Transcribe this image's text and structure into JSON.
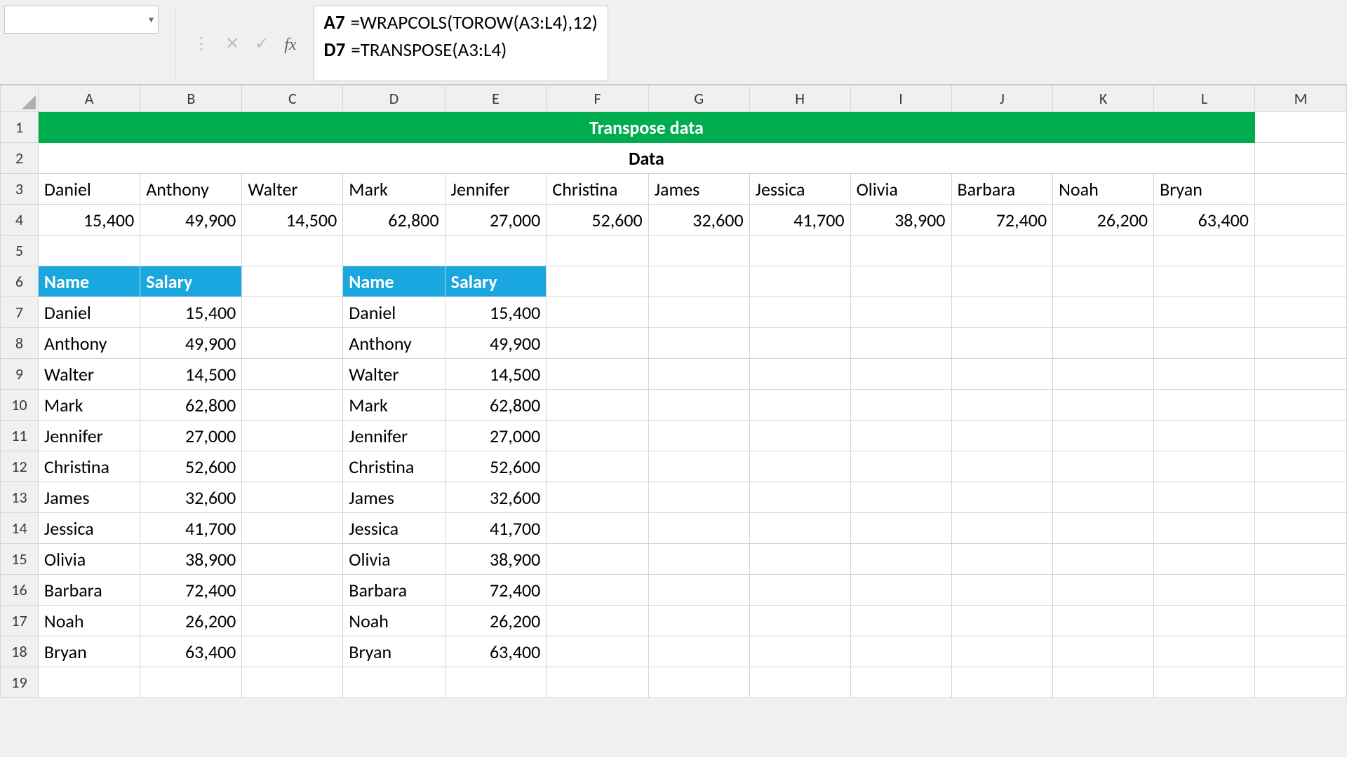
{
  "formula_bar": {
    "name_box_value": "",
    "lines": [
      {
        "ref": "A7",
        "formula": "=WRAPCOLS(TOROW(A3:L4),12)"
      },
      {
        "ref": "D7",
        "formula": "=TRANSPOSE(A3:L4)"
      }
    ]
  },
  "icons": {
    "dropdown": "▾",
    "menu_dots": "⋮",
    "cancel": "✕",
    "enter": "✓",
    "fx": "fx"
  },
  "columns": [
    "A",
    "B",
    "C",
    "D",
    "E",
    "F",
    "G",
    "H",
    "I",
    "J",
    "K",
    "L",
    "M"
  ],
  "row_numbers": [
    1,
    2,
    3,
    4,
    5,
    6,
    7,
    8,
    9,
    10,
    11,
    12,
    13,
    14,
    15,
    16,
    17,
    18,
    19
  ],
  "title_row": "Transpose data",
  "data_label": "Data",
  "names_row": [
    "Daniel",
    "Anthony",
    "Walter",
    "Mark",
    "Jennifer",
    "Christina",
    "James",
    "Jessica",
    "Olivia",
    "Barbara",
    "Noah",
    "Bryan"
  ],
  "salary_row": [
    "15,400",
    "49,900",
    "14,500",
    "62,800",
    "27,000",
    "52,600",
    "32,600",
    "41,700",
    "38,900",
    "72,400",
    "26,200",
    "63,400"
  ],
  "table_headers": {
    "name": "Name",
    "salary": "Salary"
  },
  "tableA": [
    {
      "name": "Daniel",
      "salary": "15,400"
    },
    {
      "name": "Anthony",
      "salary": "49,900"
    },
    {
      "name": "Walter",
      "salary": "14,500"
    },
    {
      "name": "Mark",
      "salary": "62,800"
    },
    {
      "name": "Jennifer",
      "salary": "27,000"
    },
    {
      "name": "Christina",
      "salary": "52,600"
    },
    {
      "name": "James",
      "salary": "32,600"
    },
    {
      "name": "Jessica",
      "salary": "41,700"
    },
    {
      "name": "Olivia",
      "salary": "38,900"
    },
    {
      "name": "Barbara",
      "salary": "72,400"
    },
    {
      "name": "Noah",
      "salary": "26,200"
    },
    {
      "name": "Bryan",
      "salary": "63,400"
    }
  ],
  "tableD": [
    {
      "name": "Daniel",
      "salary": "15,400"
    },
    {
      "name": "Anthony",
      "salary": "49,900"
    },
    {
      "name": "Walter",
      "salary": "14,500"
    },
    {
      "name": "Mark",
      "salary": "62,800"
    },
    {
      "name": "Jennifer",
      "salary": "27,000"
    },
    {
      "name": "Christina",
      "salary": "52,600"
    },
    {
      "name": "James",
      "salary": "32,600"
    },
    {
      "name": "Jessica",
      "salary": "41,700"
    },
    {
      "name": "Olivia",
      "salary": "38,900"
    },
    {
      "name": "Barbara",
      "salary": "72,400"
    },
    {
      "name": "Noah",
      "salary": "26,200"
    },
    {
      "name": "Bryan",
      "salary": "63,400"
    }
  ],
  "colors": {
    "green": "#00ad4e",
    "blue": "#1aa6df"
  }
}
